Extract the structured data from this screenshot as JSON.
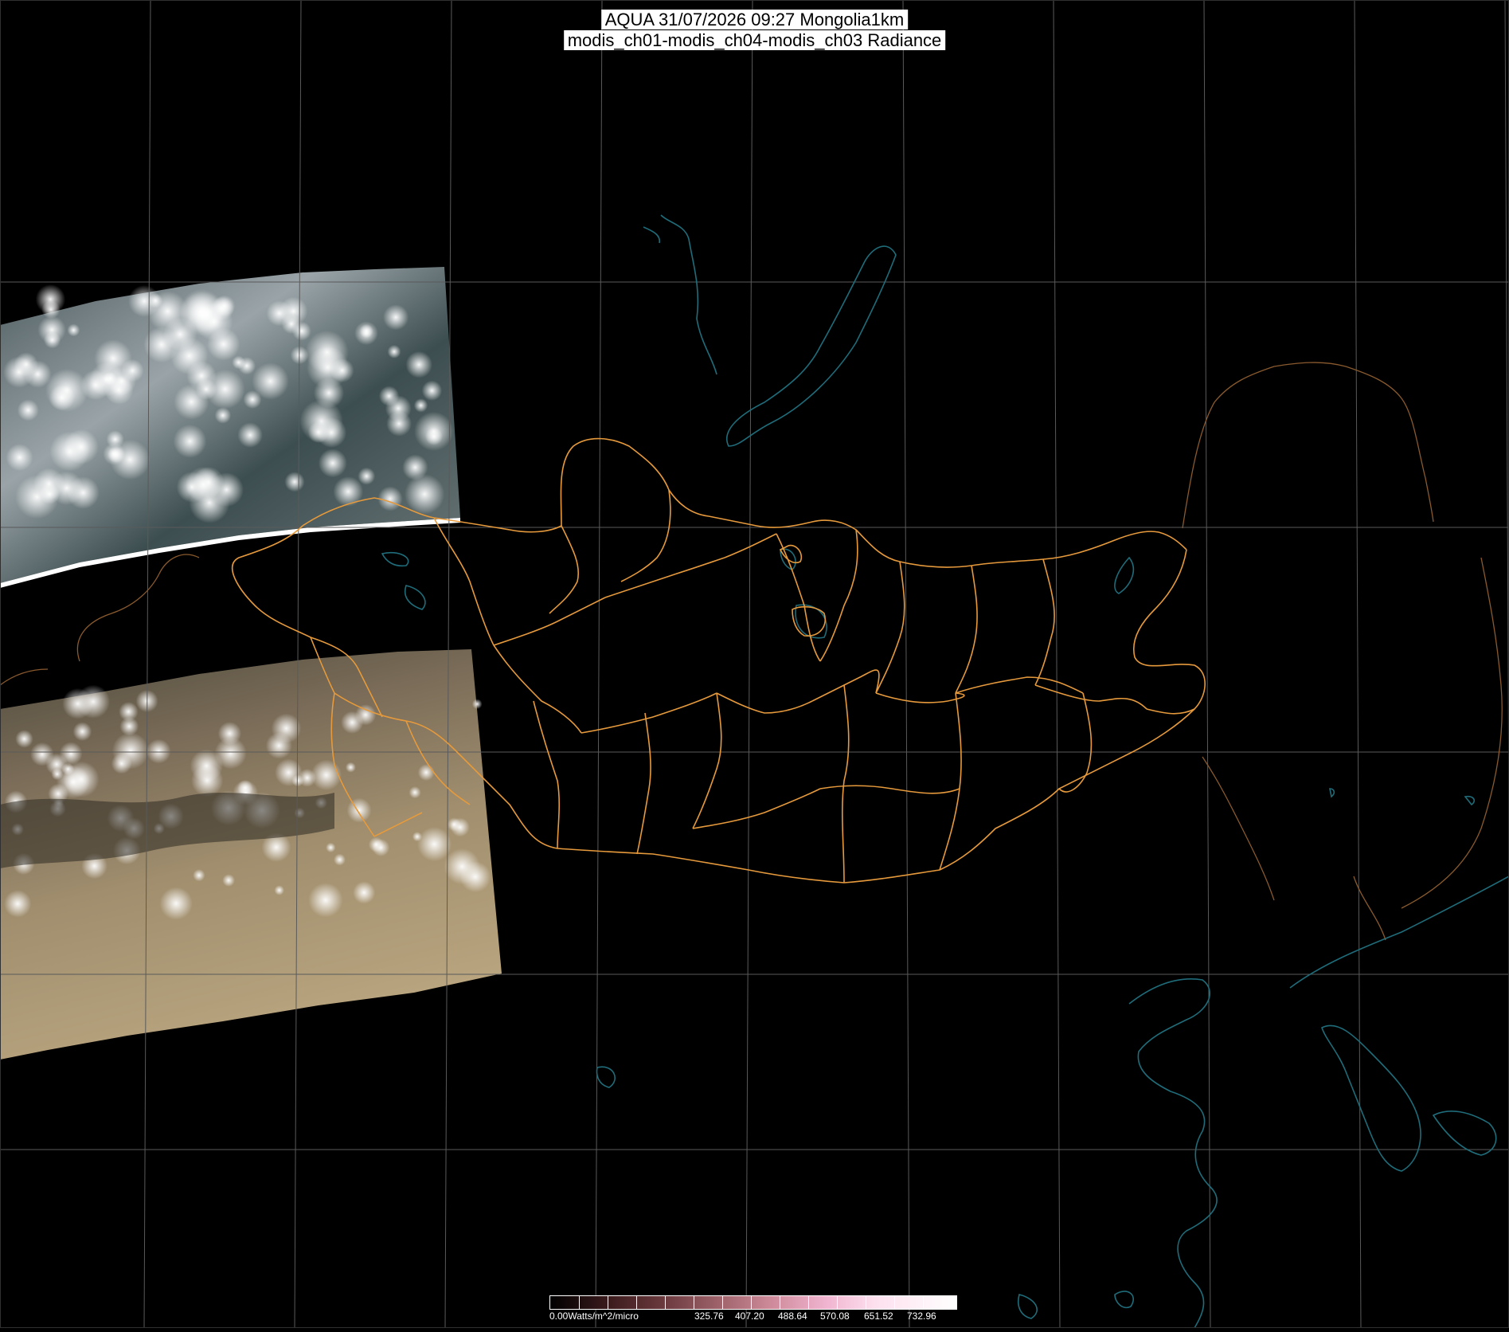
{
  "title": {
    "line1": "AQUA 31/07/2026 09:27 Mongolia1km",
    "line2": "modis_ch01-modis_ch04-modis_ch03 Radiance"
  },
  "colorbar": {
    "unit_label": "0.00Watts/m^2/micro",
    "tick_labels": [
      "325.76",
      "407.20",
      "488.64",
      "570.08",
      "651.52",
      "732.96"
    ]
  },
  "colors": {
    "background": "#000000",
    "graticule": "#5a5a5a",
    "coastline": "#1f6c7a",
    "boundaries": "#e69a3c"
  },
  "map_layers": [
    "graticule",
    "satellite-swath-north",
    "satellite-swath-south",
    "coastlines",
    "mongolia-province-boundaries",
    "country-borders"
  ]
}
